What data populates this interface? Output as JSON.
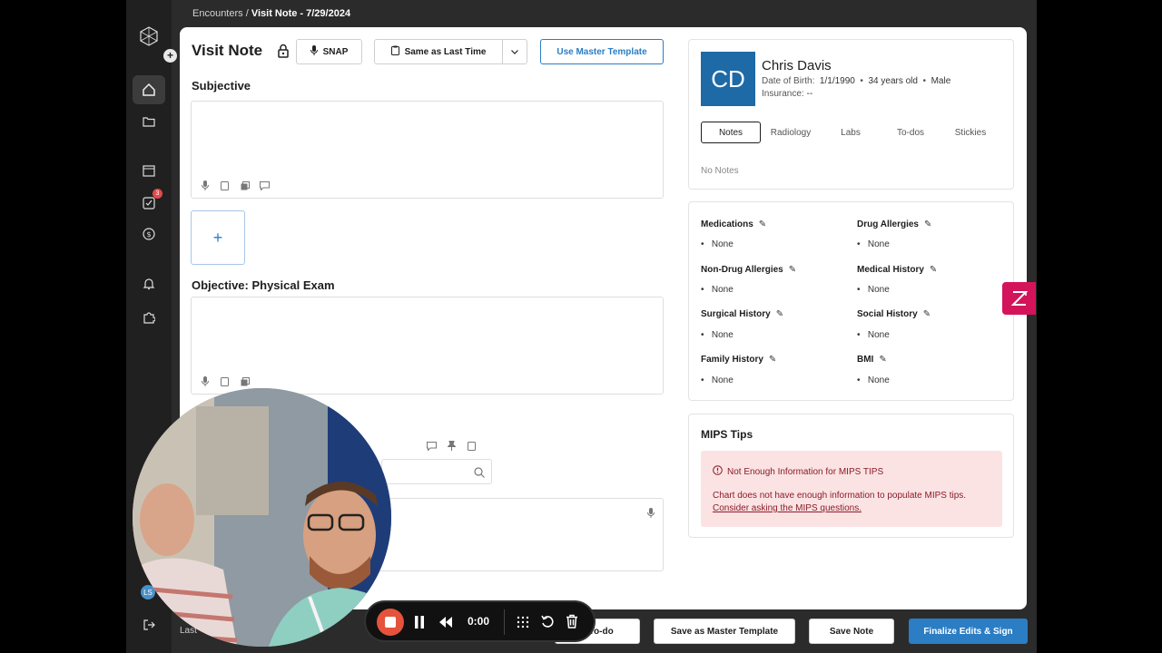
{
  "breadcrumb": {
    "parent": "Encounters",
    "separator": " / ",
    "current": "Visit Note - 7/29/2024"
  },
  "note": {
    "title": "Visit Note",
    "snap_label": "SNAP",
    "same_as_last_label": "Same as Last Time",
    "master_template_label": "Use Master Template",
    "subjective_title": "Subjective",
    "add_symbol": "+",
    "objective_title": "Objective: Physical Exam"
  },
  "sidebar": {
    "add_symbol": "+",
    "todo_badge": "3",
    "user_initials": "LS"
  },
  "patient": {
    "initials": "CD",
    "name": "Chris Davis",
    "dob_label": "Date of Birth:",
    "dob": "1/1/1990",
    "age": "34 years old",
    "sex": "Male",
    "insurance_label": "Insurance:",
    "insurance": "--",
    "tabs": [
      "Notes",
      "Radiology",
      "Labs",
      "To-dos",
      "Stickies"
    ],
    "empty_notes": "No Notes"
  },
  "history": {
    "medications": {
      "label": "Medications",
      "value": "None"
    },
    "drug_allergies": {
      "label": "Drug Allergies",
      "value": "None"
    },
    "non_drug_allergies": {
      "label": "Non-Drug Allergies",
      "value": "None"
    },
    "medical_history": {
      "label": "Medical History",
      "value": "None"
    },
    "surgical_history": {
      "label": "Surgical History",
      "value": "None"
    },
    "social_history": {
      "label": "Social History",
      "value": "None"
    },
    "family_history": {
      "label": "Family History",
      "value": "None"
    },
    "bmi": {
      "label": "BMI",
      "value": "None"
    }
  },
  "mips": {
    "title": "MIPS Tips",
    "alert_title": "Not Enough Information for MIPS TIPS",
    "alert_body": "Chart does not have enough information to populate MIPS tips.",
    "alert_link": "Consider asking the MIPS questions."
  },
  "footer": {
    "last_saved": "Last",
    "todo_label": "e To-do",
    "save_master_label": "Save as Master Template",
    "save_note_label": "Save Note",
    "finalize_label": "Finalize Edits & Sign"
  },
  "recorder": {
    "timer": "0:00"
  },
  "colors": {
    "accent": "#2b7dc4",
    "finalize": "#2b7dc4",
    "patient_avatar": "#1e6aa6",
    "alert_bg": "#fbe3e4",
    "alert_text": "#8a1c28",
    "record": "#e5533c"
  }
}
